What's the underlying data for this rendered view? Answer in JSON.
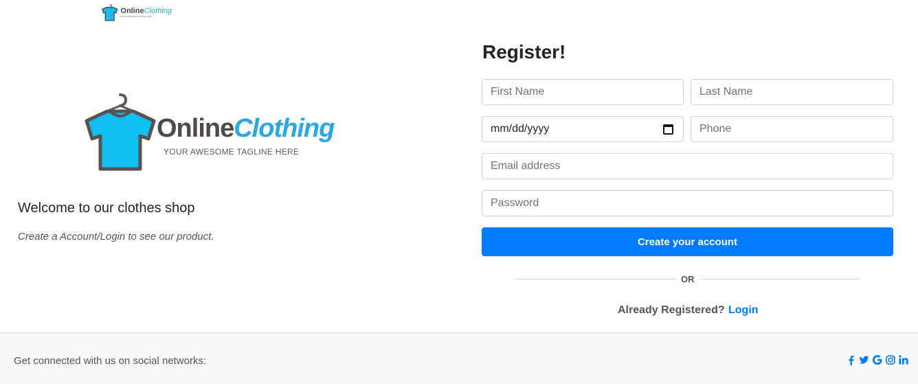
{
  "header": {
    "logo_brand_part1": "Online",
    "logo_brand_part2": "Clothing",
    "logo_tagline": "YOUR AWESOME TAGLINE HERE"
  },
  "left": {
    "logo_brand_part1": "Online",
    "logo_brand_part2": "Clothing",
    "logo_tagline": "YOUR AWESOME TAGLINE HERE",
    "welcome": "Welcome to our clothes shop",
    "subtitle": "Create a Account/Login to see our product."
  },
  "form": {
    "title": "Register!",
    "first_name_placeholder": "First Name",
    "last_name_placeholder": "Last Name",
    "date_value": "mm/dd/yyyy",
    "phone_placeholder": "Phone",
    "email_placeholder": "Email address",
    "password_placeholder": "Password",
    "submit_label": "Create your account",
    "divider_text": "OR",
    "already_text": "Already Registered?",
    "login_label": "Login"
  },
  "footer": {
    "text": "Get connected with us on social networks:",
    "social_icons": [
      "facebook-icon",
      "twitter-icon",
      "google-icon",
      "instagram-icon",
      "linkedin-icon"
    ]
  },
  "colors": {
    "primary": "#007bff",
    "brand_blue": "#29a9df",
    "footer_bg": "#f8f9fa"
  }
}
